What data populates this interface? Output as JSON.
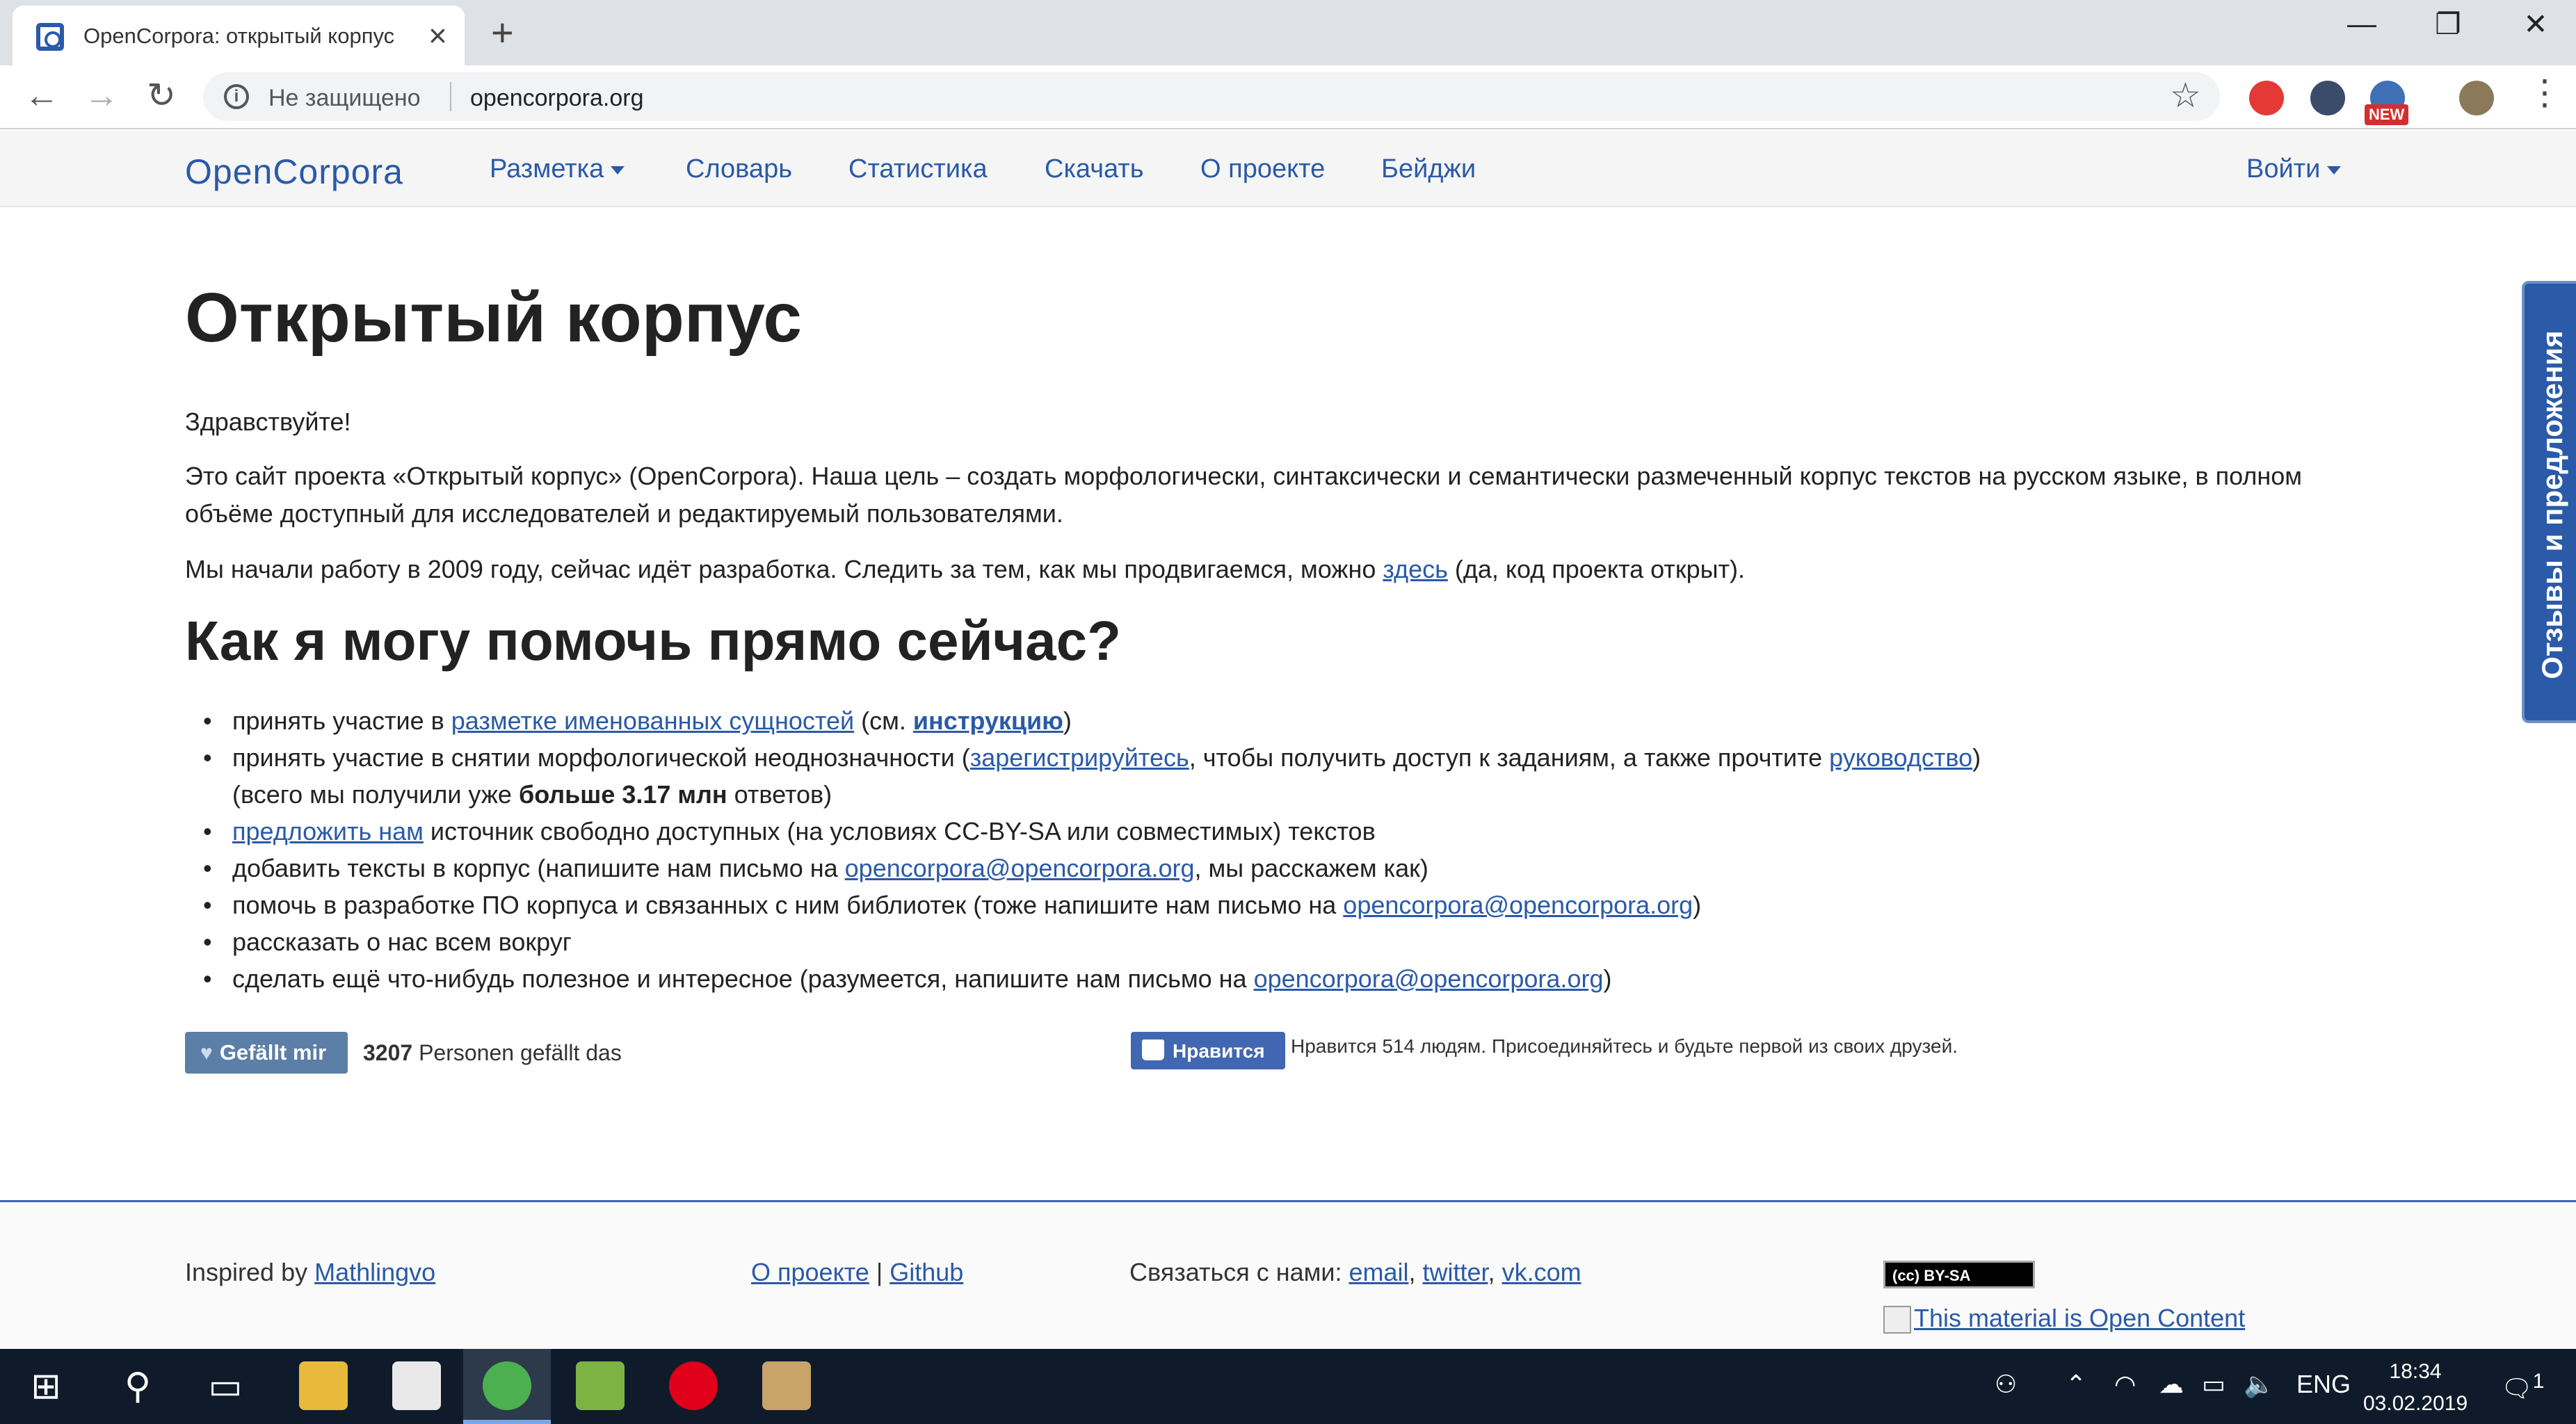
{
  "browser": {
    "tab_title": "OpenCorpora: открытый корпус",
    "new_tab_symbol": "+",
    "window_controls": {
      "minimize": "—",
      "restore": "❐",
      "close": "✕"
    },
    "security_label": "Не защищено",
    "url": "opencorpora.org",
    "ext_new_badge": "NEW"
  },
  "navbar": {
    "brand": "OpenCorpora",
    "items": [
      "Разметка",
      "Словарь",
      "Статистика",
      "Скачать",
      "О проекте",
      "Бейджи"
    ],
    "login": "Войти"
  },
  "main": {
    "title": "Открытый корпус",
    "greeting": "Здравствуйте!",
    "intro": "Это сайт проекта «Открытый корпус» (OpenCorpora). Наша цель – создать морфологически, синтаксически и семантически размеченный корпус текстов на русском языке, в полном объёме доступный для исследователей и редактируемый пользователями.",
    "progress_before": "Мы начали работу в 2009 году, сейчас идёт разработка. Следить за тем, как мы продвигаемся, можно ",
    "progress_link": "здесь",
    "progress_after": " (да, код проекта открыт).",
    "help_title": "Как я могу помочь прямо сейчас?",
    "help": {
      "i1_a": "принять участие в ",
      "i1_link": "разметке именованных сущностей",
      "i1_b": " (см. ",
      "i1_link2": "инструкцию",
      "i1_c": ")",
      "i2_a": "принять участие в снятии морфологической неоднозначности (",
      "i2_link": "зарегистрируйтесь",
      "i2_b": ", чтобы получить доступ к заданиям, а также прочтите ",
      "i2_link2": "руководство",
      "i2_c": ")",
      "i2_d": "(всего мы получили уже ",
      "i2_bold": "больше 3.17 млн",
      "i2_e": " ответов)",
      "i3_link": "предложить нам",
      "i3_text": " источник свободно доступных (на условиях CC-BY-SA или совместимых) текстов",
      "i4_a": "добавить тексты в корпус (напишите нам письмо на ",
      "i4_link": "opencorpora@opencorpora.org",
      "i4_b": ", мы расскажем как)",
      "i5_a": "помочь в разработке ПО корпуса и связанных с ним библиотек (тоже напишите нам письмо на ",
      "i5_link": "opencorpora@opencorpora.org",
      "i5_b": ")",
      "i6": "рассказать о нас всем вокруг",
      "i7_a": "сделать ещё что-нибудь полезное и интересное (разумеется, напишите нам письмо на ",
      "i7_link": "opencorpora@opencorpora.org",
      "i7_b": ")"
    }
  },
  "social": {
    "like_label": "Gefällt mir",
    "like_count": "3207",
    "like_suffix": " Personen gefällt das",
    "fb_label": "Нравится",
    "fb_text": "Нравится 514 людям. Присоединяйтесь и будьте первой из своих друзей."
  },
  "footer": {
    "inspired_text": "Inspired by ",
    "inspired_link": "Mathlingvo",
    "about_link": "О проекте",
    "sep": " | ",
    "github_link": "Github",
    "contact_text": "Связаться с нами: ",
    "email_link": "email",
    "twitter_link": "twitter",
    "vk_link": "vk.com",
    "comma": ", ",
    "cc_badge": "(cc) BY-SA",
    "open_content_alt": "This material is Open Content"
  },
  "feedback_tab": "Отзывы и предложения",
  "taskbar": {
    "lang": "ENG",
    "time": "18:34",
    "date": "03.02.2019",
    "notifications": "1"
  },
  "colors": {
    "link": "#2a5aa8",
    "footer_border": "#3366cc",
    "like_button": "#5b7fa6",
    "fb_button": "#4267b2"
  }
}
